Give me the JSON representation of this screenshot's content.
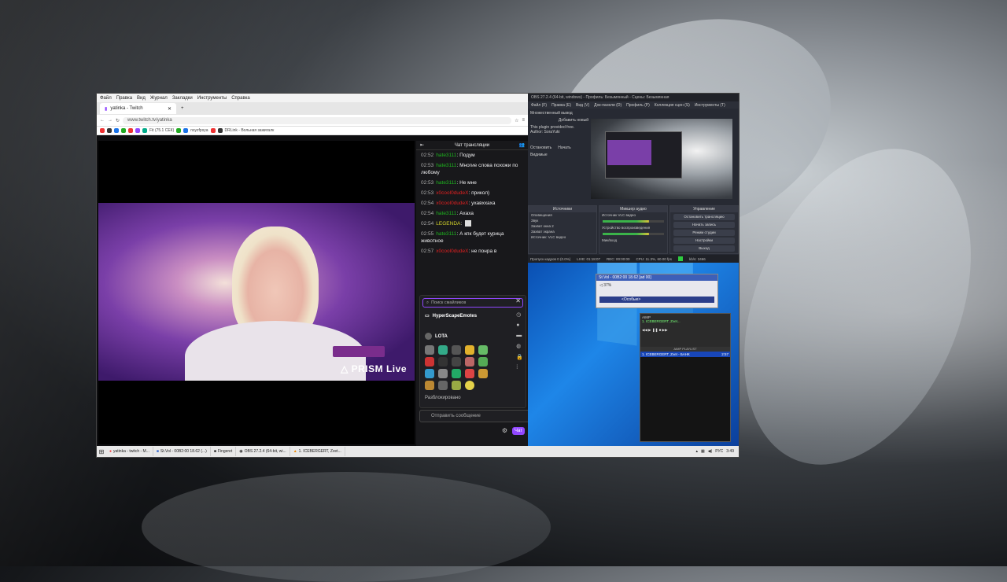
{
  "browser": {
    "menu": [
      "Файл",
      "Правка",
      "Вид",
      "Журнал",
      "Закладки",
      "Инструменты",
      "Справка"
    ],
    "tab_title": "yatinka - Twitch",
    "url": "www.twitch.tv/yatinka",
    "bookmarks": [
      "Fit (75.1 СЕК)",
      "nsyzfpsya",
      "DRLink - Вольная зажигалк"
    ]
  },
  "video": {
    "overlay_logo": "PRISM Live"
  },
  "chat": {
    "header": "Чат трансляции",
    "messages": [
      {
        "time": "02:52",
        "user": "hate3111",
        "user_color": "#1eb51e",
        "text": "Подум"
      },
      {
        "time": "02:53",
        "user": "hate3111",
        "user_color": "#1eb51e",
        "text": "Многие слова похожи по любому"
      },
      {
        "time": "02:53",
        "user": "hate3111",
        "user_color": "#1eb51e",
        "text": "Не мне"
      },
      {
        "time": "02:53",
        "user": "x0cool0dudeX",
        "user_color": "#e02020",
        "text": "прикол)"
      },
      {
        "time": "02:54",
        "user": "x0cool0dudeX",
        "user_color": "#e02020",
        "text": "ухавххаха"
      },
      {
        "time": "02:54",
        "user": "hate3111",
        "user_color": "#1eb51e",
        "text": "Ахаха"
      },
      {
        "time": "02:54",
        "user": "LEGENDA",
        "user_color": "#d6d62a",
        "text": ""
      },
      {
        "time": "02:55",
        "user": "hate3111",
        "user_color": "#1eb51e",
        "text": "А кпк будет курица животное"
      },
      {
        "time": "02:57",
        "user": "x0cool0dudeX",
        "user_color": "#e02020",
        "text": "не понра в"
      }
    ],
    "emote_search_placeholder": "Поиск смайликов",
    "emote_sections": [
      "HyperScapeEmotes",
      "LOTA",
      "Разблокировано"
    ],
    "input_placeholder": "Отправить сообщение",
    "send_label": "Чат"
  },
  "obs": {
    "title": "OBS 27.2.4 (64-bit, windows) - Профиль: Безымянный - Сцены: Безымянная",
    "menu": [
      "Файл (F)",
      "Правка (E)",
      "Вид (V)",
      "Док-панели (D)",
      "Профиль (P)",
      "Коллекция сцен (S)",
      "Инструменты (T)"
    ],
    "left_panel": [
      "Множественный вывод",
      "Добавить новый",
      "This plugin provided free.",
      "Author: SoraYuki",
      "Остановить",
      "Начать",
      "Видимые"
    ],
    "docks": [
      {
        "title": "Источники",
        "rows": [
          "Оповещения",
          "Звук",
          "Захват окна 2",
          "Захват экрана",
          "Источник: VLC видео"
        ]
      },
      {
        "title": "Микшер аудио",
        "rows": [
          "Источник VLC видео",
          "Устройство воспроизведения",
          "Мик/вход"
        ]
      },
      {
        "title": "Управление",
        "rows": [
          "Остановить трансляцию",
          "Начать запись",
          "Режим студии",
          "Настройки",
          "Выход"
        ]
      }
    ],
    "status": [
      "Пропуск кадров 0 (0.0%)",
      "LIVE: 01:18:07",
      "REC: 00:00:00",
      "CPU: 11.3%, 60.00 fps",
      "kb/s: 3466"
    ]
  },
  "stvol": {
    "title": "St.Vol - 00B2:00 18.62 [ad 00]",
    "value": "37%",
    "bar_label": "<Особые>"
  },
  "aimp": {
    "title": "AIMP",
    "display": "1. ICEBERGERT, Zvet...",
    "playlist_title": "AIMP PLAYLIST",
    "track_title": "1. ICEBERGERT, Zvet - БАНК",
    "track_time": "2:57"
  },
  "taskbar": {
    "items": [
      "yatinka - twitch - M...",
      "St.Vol - 00B2:00 18.62 (...)",
      "Fingeret",
      "OBS 27.2.4 (64-bit, wi...",
      "1. ICEBERGERT, Zvet..."
    ],
    "lang": "РУС",
    "time": "3:49"
  }
}
